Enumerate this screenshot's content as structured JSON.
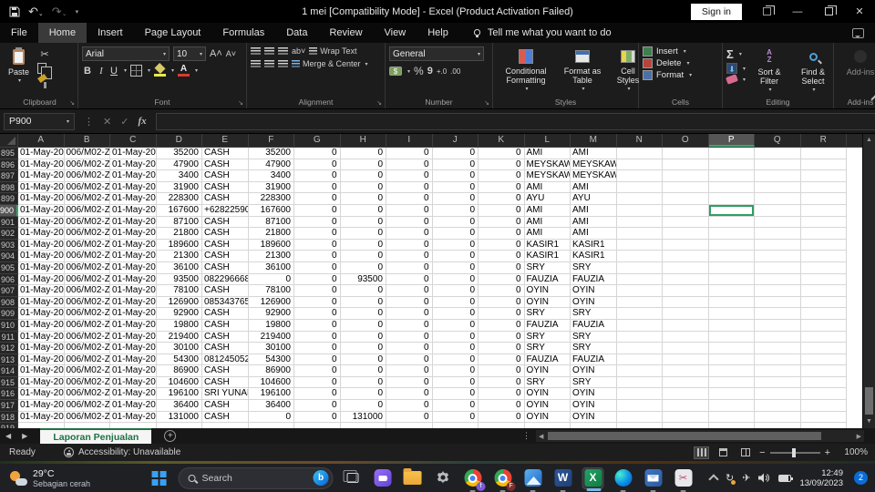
{
  "titlebar": {
    "title": "1 mei  [Compatibility Mode]  -  Excel (Product Activation Failed)",
    "sign_in": "Sign in",
    "quick_access_icons": [
      "save-icon",
      "undo-icon",
      "redo-icon",
      "customize-quick-access-icon"
    ]
  },
  "menu": {
    "tabs": [
      "File",
      "Home",
      "Insert",
      "Page Layout",
      "Formulas",
      "Data",
      "Review",
      "View",
      "Help"
    ],
    "active_tab": "Home",
    "tell_me": "Tell me what you want to do"
  },
  "ribbon": {
    "clipboard": {
      "label": "Clipboard",
      "paste": "Paste"
    },
    "font": {
      "label": "Font",
      "font_name": "Arial",
      "font_size": "10",
      "bold": "B",
      "italic": "I",
      "underline": "U",
      "grow_font": "A",
      "shrink_font": "A"
    },
    "alignment": {
      "label": "Alignment",
      "wrap_text": "Wrap Text",
      "merge_center": "Merge & Center"
    },
    "number": {
      "label": "Number",
      "format": "General",
      "percent": "%",
      "comma": "9",
      "inc_decimal": "+.0",
      "dec_decimal": ".00"
    },
    "styles": {
      "label": "Styles",
      "conditional_formatting": "Conditional Formatting",
      "format_as_table": "Format as Table",
      "cell_styles": "Cell Styles"
    },
    "cells": {
      "label": "Cells",
      "insert": "Insert",
      "delete": "Delete",
      "format": "Format"
    },
    "editing": {
      "label": "Editing",
      "autosum_glyph": "Σ",
      "sort_filter": "Sort & Filter",
      "find_select": "Find & Select"
    },
    "addins": {
      "label": "Add-ins",
      "button": "Add-ins"
    }
  },
  "formula_bar": {
    "cell_reference": "P900",
    "fx_label": "fx"
  },
  "sheet": {
    "columns": [
      "A",
      "B",
      "C",
      "D",
      "E",
      "F",
      "G",
      "H",
      "I",
      "J",
      "K",
      "L",
      "M",
      "N",
      "O",
      "P",
      "Q",
      "R"
    ],
    "selected_column": "P",
    "selected_row": 900,
    "selected_cell": "P900",
    "rows": [
      {
        "n": 895,
        "c": [
          "01-May-20",
          "006/M02-Z",
          "01-May-20",
          "35200",
          "CASH",
          "35200",
          "0",
          "0",
          "0",
          "0",
          "0",
          "AMI",
          "AMI"
        ]
      },
      {
        "n": 896,
        "c": [
          "01-May-20",
          "006/M02-Z",
          "01-May-20",
          "47900",
          "CASH",
          "47900",
          "0",
          "0",
          "0",
          "0",
          "0",
          "MEYSKAWATI",
          "MEYSKAWATI"
        ]
      },
      {
        "n": 897,
        "c": [
          "01-May-20",
          "006/M02-Z",
          "01-May-20",
          "3400",
          "CASH",
          "3400",
          "0",
          "0",
          "0",
          "0",
          "0",
          "MEYSKAWATI",
          "MEYSKAWATI"
        ]
      },
      {
        "n": 898,
        "c": [
          "01-May-20",
          "006/M02-Z",
          "01-May-20",
          "31900",
          "CASH",
          "31900",
          "0",
          "0",
          "0",
          "0",
          "0",
          "AMI",
          "AMI"
        ]
      },
      {
        "n": 899,
        "c": [
          "01-May-20",
          "006/M02-Z",
          "01-May-20",
          "228300",
          "CASH",
          "228300",
          "0",
          "0",
          "0",
          "0",
          "0",
          "AYU",
          "AYU"
        ]
      },
      {
        "n": 900,
        "c": [
          "01-May-20",
          "006/M02-Z",
          "01-May-20",
          "167600",
          "+62822590",
          "167600",
          "0",
          "0",
          "0",
          "0",
          "0",
          "AMI",
          "AMI"
        ]
      },
      {
        "n": 901,
        "c": [
          "01-May-20",
          "006/M02-Z",
          "01-May-20",
          "87100",
          "CASH",
          "87100",
          "0",
          "0",
          "0",
          "0",
          "0",
          "AMI",
          "AMI"
        ]
      },
      {
        "n": 902,
        "c": [
          "01-May-20",
          "006/M02-Z",
          "01-May-20",
          "21800",
          "CASH",
          "21800",
          "0",
          "0",
          "0",
          "0",
          "0",
          "AMI",
          "AMI"
        ]
      },
      {
        "n": 903,
        "c": [
          "01-May-20",
          "006/M02-Z",
          "01-May-20",
          "189600",
          "CASH",
          "189600",
          "0",
          "0",
          "0",
          "0",
          "0",
          "KASIR1",
          "KASIR1"
        ]
      },
      {
        "n": 904,
        "c": [
          "01-May-20",
          "006/M02-Z",
          "01-May-20",
          "21300",
          "CASH",
          "21300",
          "0",
          "0",
          "0",
          "0",
          "0",
          "KASIR1",
          "KASIR1"
        ]
      },
      {
        "n": 905,
        "c": [
          "01-May-20",
          "006/M02-Z",
          "01-May-20",
          "36100",
          "CASH",
          "36100",
          "0",
          "0",
          "0",
          "0",
          "0",
          "SRY",
          "SRY"
        ]
      },
      {
        "n": 906,
        "c": [
          "01-May-20",
          "006/M02-Z",
          "01-May-20",
          "93500",
          "082296668",
          "0",
          "0",
          "93500",
          "0",
          "0",
          "0",
          "FAUZIA",
          "FAUZIA"
        ]
      },
      {
        "n": 907,
        "c": [
          "01-May-20",
          "006/M02-Z",
          "01-May-20",
          "78100",
          "CASH",
          "78100",
          "0",
          "0",
          "0",
          "0",
          "0",
          "OYIN",
          "OYIN"
        ]
      },
      {
        "n": 908,
        "c": [
          "01-May-20",
          "006/M02-Z",
          "01-May-20",
          "126900",
          "085343765",
          "126900",
          "0",
          "0",
          "0",
          "0",
          "0",
          "OYIN",
          "OYIN"
        ]
      },
      {
        "n": 909,
        "c": [
          "01-May-20",
          "006/M02-Z",
          "01-May-20",
          "92900",
          "CASH",
          "92900",
          "0",
          "0",
          "0",
          "0",
          "0",
          "SRY",
          "SRY"
        ]
      },
      {
        "n": 910,
        "c": [
          "01-May-20",
          "006/M02-Z",
          "01-May-20",
          "19800",
          "CASH",
          "19800",
          "0",
          "0",
          "0",
          "0",
          "0",
          "FAUZIA",
          "FAUZIA"
        ]
      },
      {
        "n": 911,
        "c": [
          "01-May-20",
          "006/M02-Z",
          "01-May-20",
          "219400",
          "CASH",
          "219400",
          "0",
          "0",
          "0",
          "0",
          "0",
          "SRY",
          "SRY"
        ]
      },
      {
        "n": 912,
        "c": [
          "01-May-20",
          "006/M02-Z",
          "01-May-20",
          "30100",
          "CASH",
          "30100",
          "0",
          "0",
          "0",
          "0",
          "0",
          "SRY",
          "SRY"
        ]
      },
      {
        "n": 913,
        "c": [
          "01-May-20",
          "006/M02-Z",
          "01-May-20",
          "54300",
          "081245052",
          "54300",
          "0",
          "0",
          "0",
          "0",
          "0",
          "FAUZIA",
          "FAUZIA"
        ]
      },
      {
        "n": 914,
        "c": [
          "01-May-20",
          "006/M02-Z",
          "01-May-20",
          "86900",
          "CASH",
          "86900",
          "0",
          "0",
          "0",
          "0",
          "0",
          "OYIN",
          "OYIN"
        ]
      },
      {
        "n": 915,
        "c": [
          "01-May-20",
          "006/M02-Z",
          "01-May-20",
          "104600",
          "CASH",
          "104600",
          "0",
          "0",
          "0",
          "0",
          "0",
          "SRY",
          "SRY"
        ]
      },
      {
        "n": 916,
        "c": [
          "01-May-20",
          "006/M02-Z",
          "01-May-20",
          "196100",
          "SRI YUNAN",
          "196100",
          "0",
          "0",
          "0",
          "0",
          "0",
          "OYIN",
          "OYIN"
        ]
      },
      {
        "n": 917,
        "c": [
          "01-May-20",
          "006/M02-Z",
          "01-May-20",
          "36400",
          "CASH",
          "36400",
          "0",
          "0",
          "0",
          "0",
          "0",
          "OYIN",
          "OYIN"
        ]
      },
      {
        "n": 918,
        "c": [
          "01-May-20",
          "006/M02-Z",
          "01-May-20",
          "131000",
          "CASH",
          "0",
          "0",
          "131000",
          "0",
          "0",
          "0",
          "OYIN",
          "OYIN"
        ]
      },
      {
        "n": 919,
        "c": []
      }
    ],
    "tab_name": "Laporan Penjualan"
  },
  "statusbar": {
    "ready": "Ready",
    "accessibility": "Accessibility: Unavailable",
    "zoom_level": "100%"
  },
  "taskbar": {
    "temperature": "29°C",
    "weather": "Sebagian cerah",
    "search_placeholder": "Search",
    "time": "12:49",
    "date": "13/09/2023",
    "notification_count": "2",
    "pinned_icons": [
      "start",
      "search",
      "task-view",
      "chat",
      "file-explorer",
      "settings",
      "chrome-profile-1",
      "chrome-profile-2",
      "photos",
      "word",
      "excel",
      "edge",
      "mail",
      "snipping-tool"
    ],
    "tray_icons": [
      "hidden-icons-chevron",
      "sync",
      "airplane",
      "volume",
      "battery"
    ]
  },
  "colors": {
    "excel_green": "#107c41",
    "tab_accent_green": "#1e7145",
    "selection_border_green": "#2f9e63",
    "taskbar_badge_blue": "#0a6cd6",
    "start_blue": "#3aa0f3"
  }
}
